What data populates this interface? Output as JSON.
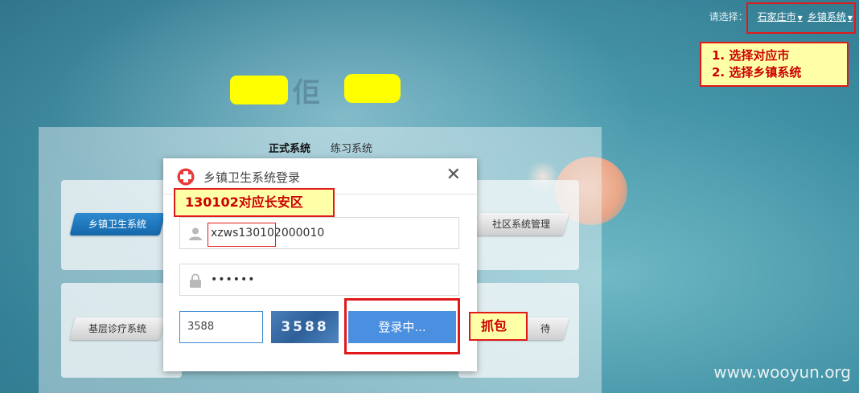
{
  "topbar": {
    "prompt": "请选择：",
    "city": "石家庄市",
    "system": "乡镇系统"
  },
  "notes": {
    "step1": "1. 选择对应市",
    "step2": "2. 选择乡镇系统",
    "area": "130102对应长安区",
    "capture": "抓包"
  },
  "logo": {
    "glyph": "佢"
  },
  "tabs": [
    "正式系统",
    "练习系统"
  ],
  "systems": {
    "township": "乡镇卫生系统",
    "community": "社区系统管理",
    "basic": "基层诊疗系统",
    "partial": "待"
  },
  "dialog": {
    "title": "乡镇卫生系统登录",
    "close": "✕",
    "username": "xzws130102000010",
    "password": "••••••",
    "captcha_input": "3588",
    "captcha_image": "3588",
    "login_label": "登录中..."
  },
  "watermark": "www.wooyun.org",
  "colors": {
    "accent": "#4a8fe0",
    "highlight": "#e0191b",
    "note_bg": "#ffffa8"
  }
}
